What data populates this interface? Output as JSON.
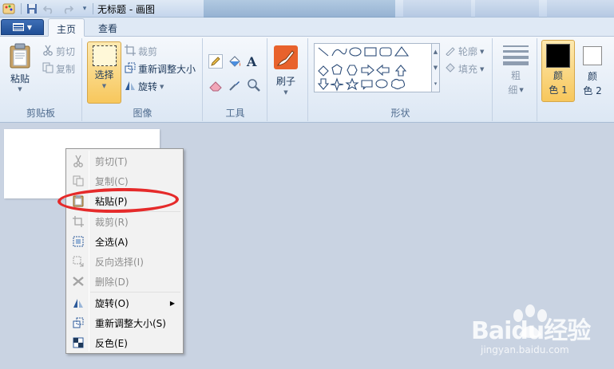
{
  "window": {
    "title": "无标题 - 画图"
  },
  "quick_access": {
    "items": [
      "save-icon",
      "undo-icon",
      "redo-icon",
      "customize-icon"
    ]
  },
  "tabs": [
    {
      "label": "主页",
      "active": true
    },
    {
      "label": "查看",
      "active": false
    }
  ],
  "ribbon": {
    "clipboard": {
      "label": "剪贴板",
      "paste": "粘贴",
      "cut": "剪切",
      "copy": "复制"
    },
    "image": {
      "label": "图像",
      "select": "选择",
      "crop": "裁剪",
      "resize": "重新调整大小",
      "rotate": "旋转"
    },
    "tools": {
      "label": "工具"
    },
    "brushes": {
      "label": "刷子"
    },
    "shapes": {
      "label": "形状",
      "outline": "轮廓",
      "fill": "填充"
    },
    "size": {
      "label_1": "粗",
      "label_2": "细"
    },
    "color1": {
      "label_1": "颜",
      "label_2": "色 1",
      "value": "#000000"
    },
    "color2": {
      "label_1": "颜",
      "label_2": "色 2",
      "value": "#ffffff"
    }
  },
  "context_menu": {
    "items": [
      {
        "label": "剪切(T)",
        "icon": "scissors-icon",
        "enabled": false
      },
      {
        "label": "复制(C)",
        "icon": "copy-icon",
        "enabled": false
      },
      {
        "label": "粘贴(P)",
        "icon": "paste-icon",
        "enabled": true,
        "highlighted": true
      },
      {
        "label": "裁剪(R)",
        "icon": "crop-icon",
        "enabled": false
      },
      {
        "label": "全选(A)",
        "icon": "select-all-icon",
        "enabled": true
      },
      {
        "label": "反向选择(I)",
        "icon": "invert-selection-icon",
        "enabled": false
      },
      {
        "label": "删除(D)",
        "icon": "delete-icon",
        "enabled": false
      },
      {
        "label": "旋转(O)",
        "icon": "rotate-icon",
        "enabled": true,
        "submenu": true
      },
      {
        "label": "重新调整大小(S)",
        "icon": "resize-icon",
        "enabled": true
      },
      {
        "label": "反色(E)",
        "icon": "invert-color-icon",
        "enabled": true
      }
    ]
  },
  "annotation": {
    "color": "#e52a2a"
  },
  "watermark": {
    "brand": "Baidu经验",
    "site": "jingyan.baidu.com"
  }
}
